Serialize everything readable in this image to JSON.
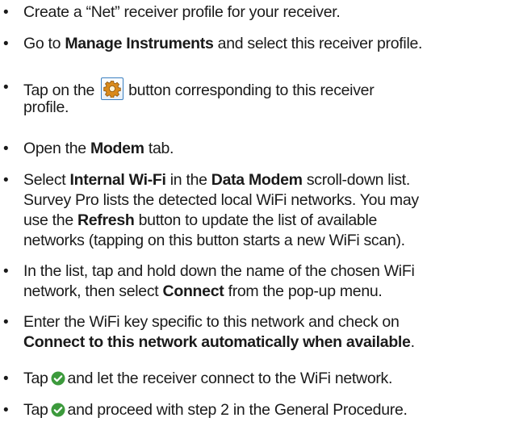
{
  "bullet_glyph": "•",
  "steps": [
    {
      "text": "Create a “Net” receiver profile for your receiver."
    },
    {
      "pre": "Go to ",
      "b1": "Manage Instruments",
      "post": " and select this receiver profile."
    },
    {
      "pre": "Tap on the",
      "icon": "gear-icon",
      "post_line1": "button corresponding to this receiver",
      "line2": "profile."
    },
    {
      "pre": "Open the ",
      "b1": "Modem",
      "post": " tab."
    },
    {
      "line1_pre": "Select ",
      "line1_b1": "Internal Wi-Fi",
      "line1_mid": " in the ",
      "line1_b2": "Data Modem",
      "line1_post": " scroll-down list.",
      "line2": "Survey Pro lists the detected local WiFi networks. You may",
      "line3_pre": "use the ",
      "line3_b1": "Refresh",
      "line3_post": " button to update the list of available",
      "line4": "networks (tapping on this button starts a new WiFi scan)."
    },
    {
      "line1": "In the list, tap and hold down the name of the chosen WiFi",
      "line2_pre": "network, then select ",
      "line2_b1": "Connect",
      "line2_post": " from the pop-up menu."
    },
    {
      "line1": "Enter the WiFi key specific to this network and check on",
      "line2_b1": "Connect to this network automatically when available",
      "line2_post": "."
    },
    {
      "pre": "Tap",
      "icon": "checkmark-ok-icon",
      "post": "and let the receiver connect to the WiFi network."
    },
    {
      "pre": "Tap",
      "icon": "checkmark-ok-icon",
      "post": "and proceed with step 2 in the General Procedure."
    }
  ],
  "colors": {
    "text": "#1a1a1a",
    "ok_green": "#3c9a3c",
    "gear_orange": "#d98a1c",
    "button_border": "#3a7fc0"
  }
}
